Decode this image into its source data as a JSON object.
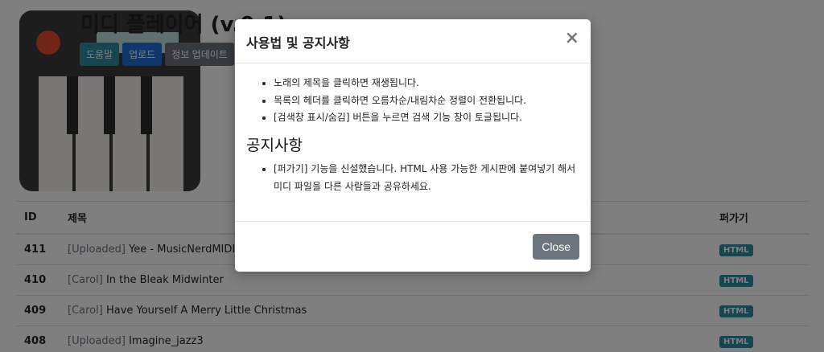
{
  "app": {
    "title": "미디 플레이어 (v.0.1)",
    "buttons": {
      "help": "도움말",
      "upload": "업로드",
      "update": "정보 업데이트"
    }
  },
  "table": {
    "headers": {
      "id": "ID",
      "title": "제목",
      "embed": "퍼가기"
    },
    "rows": [
      {
        "id": "411",
        "category": "[Uploaded]",
        "title": "Yee - MusicNerdMIDI",
        "embed": "HTML"
      },
      {
        "id": "410",
        "category": "[Carol]",
        "title": "In the Bleak Midwinter",
        "embed": "HTML"
      },
      {
        "id": "409",
        "category": "[Carol]",
        "title": "Have Yourself A Merry Little Christmas",
        "embed": "HTML"
      },
      {
        "id": "408",
        "category": "[Uploaded]",
        "title": "Imagine_jazz3",
        "embed": "HTML"
      }
    ]
  },
  "modal": {
    "title": "사용법 및 공지사항",
    "close_symbol": "×",
    "usage": [
      "노래의 제목을 클릭하면 재생됩니다.",
      "목록의 헤더를 클릭하면 오름차순/내림차순 정렬이 전환됩니다.",
      "[검색창 표시/숨김] 버튼을 누르면 검색 기능 창이 토글됩니다."
    ],
    "notice_heading": "공지사항",
    "notices": [
      "[퍼가기] 기능을 신설했습니다. HTML 사용 가능한 게시판에 붙여넣기 해서 미디 파일을 다른 사람들과 공유하세요."
    ],
    "close_label": "Close"
  }
}
